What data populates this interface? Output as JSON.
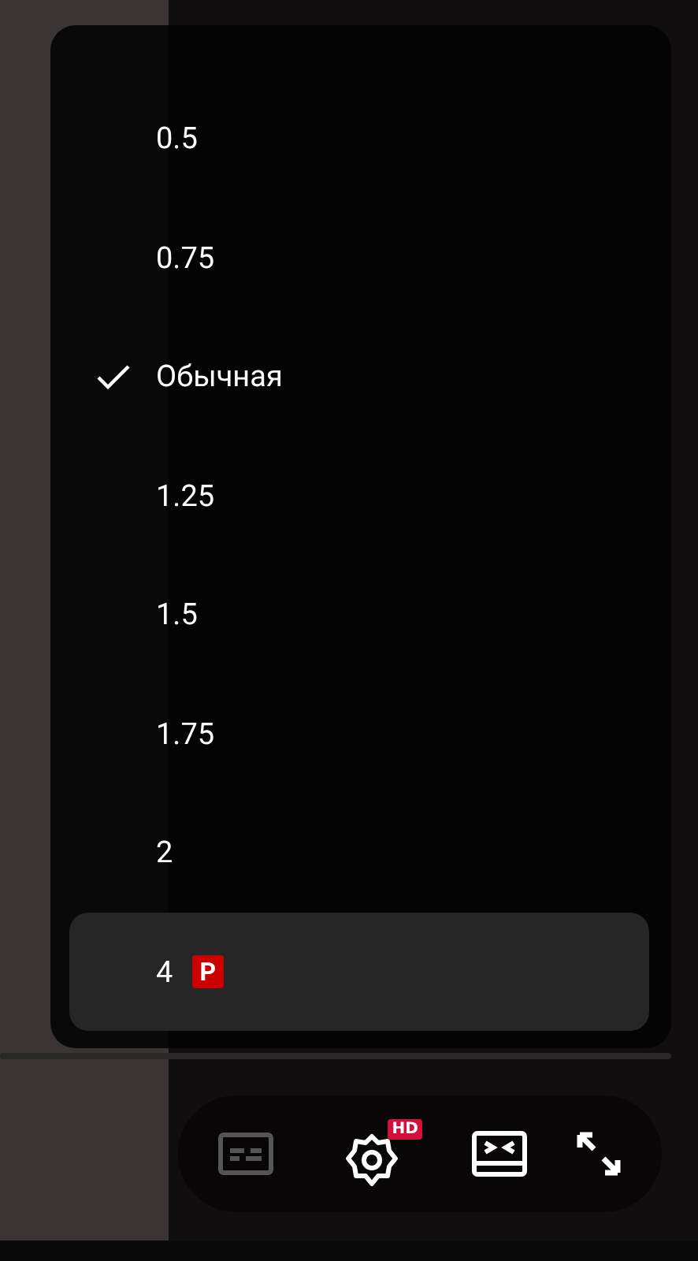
{
  "speed_menu": {
    "items": [
      {
        "label": "0.5",
        "selected": false,
        "highlighted": false
      },
      {
        "label": "0.75",
        "selected": false,
        "highlighted": false
      },
      {
        "label": "Обычная",
        "selected": true,
        "highlighted": false
      },
      {
        "label": "1.25",
        "selected": false,
        "highlighted": false
      },
      {
        "label": "1.5",
        "selected": false,
        "highlighted": false
      },
      {
        "label": "1.75",
        "selected": false,
        "highlighted": false
      },
      {
        "label": "2",
        "selected": false,
        "highlighted": false
      },
      {
        "label": "4",
        "selected": false,
        "highlighted": true,
        "badge": "P"
      }
    ]
  },
  "player_controls": {
    "subtitles_disabled": true,
    "settings_badge": "HD"
  }
}
